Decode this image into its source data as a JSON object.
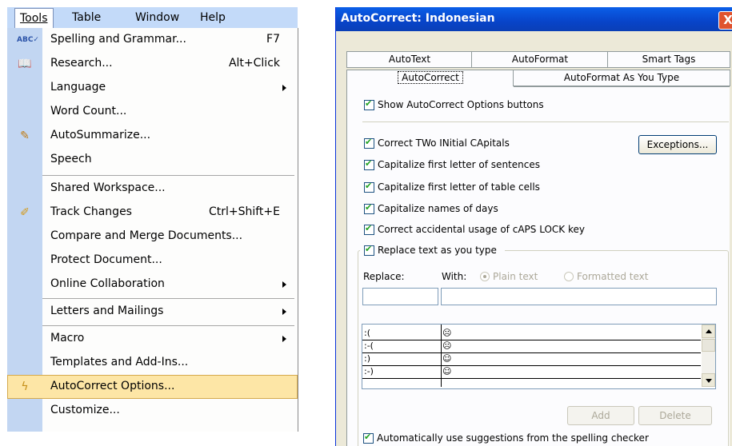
{
  "menubar": {
    "tools": "Tools",
    "table": "Table",
    "window": "Window",
    "help": "Help"
  },
  "tools_menu": {
    "items": [
      {
        "label": "Spelling and Grammar...",
        "shortcut": "F7",
        "icon": "spelling-icon"
      },
      {
        "label": "Research...",
        "shortcut": "Alt+Click",
        "icon": "research-icon"
      },
      {
        "label": "Language",
        "submenu": true
      },
      {
        "label": "Word Count..."
      },
      {
        "label": "AutoSummarize...",
        "icon": "autosummarize-icon"
      },
      {
        "label": "Speech"
      },
      {
        "label": "Shared Workspace..."
      },
      {
        "label": "Track Changes",
        "shortcut": "Ctrl+Shift+E",
        "icon": "track-changes-icon"
      },
      {
        "label": "Compare and Merge Documents..."
      },
      {
        "label": "Protect Document..."
      },
      {
        "label": "Online Collaboration",
        "submenu": true
      },
      {
        "label": "Letters and Mailings",
        "submenu": true
      },
      {
        "label": "Macro",
        "submenu": true
      },
      {
        "label": "Templates and Add-Ins..."
      },
      {
        "label": "AutoCorrect Options...",
        "icon": "autocorrect-icon",
        "highlighted": true
      },
      {
        "label": "Customize..."
      }
    ]
  },
  "dialog": {
    "title": "AutoCorrect: Indonesian",
    "close": "X",
    "tabs_back": [
      "AutoText",
      "AutoFormat",
      "Smart Tags"
    ],
    "tabs_front": [
      "AutoCorrect",
      "AutoFormat As You Type"
    ],
    "active_tab": "AutoCorrect",
    "show_buttons": "Show AutoCorrect Options buttons",
    "options": [
      "Correct TWo INitial CApitals",
      "Capitalize first letter of sentences",
      "Capitalize first letter of table cells",
      "Capitalize names of days",
      "Correct accidental usage of cAPS LOCK key"
    ],
    "exceptions": "Exceptions...",
    "replace_group": "Replace text as you type",
    "replace_label": "Replace:",
    "with_label": "With:",
    "plain_text": "Plain text",
    "formatted_text": "Formatted text",
    "replace_value": "",
    "with_value": "",
    "rows": [
      {
        "replace": ":(",
        "with": "☹"
      },
      {
        "replace": ":-(",
        "with": "☹"
      },
      {
        "replace": ":)",
        "with": "☺"
      },
      {
        "replace": ":-)",
        "with": "☺"
      }
    ],
    "add": "Add",
    "delete": "Delete",
    "auto_suggest": "Automatically use suggestions from the spelling checker"
  }
}
